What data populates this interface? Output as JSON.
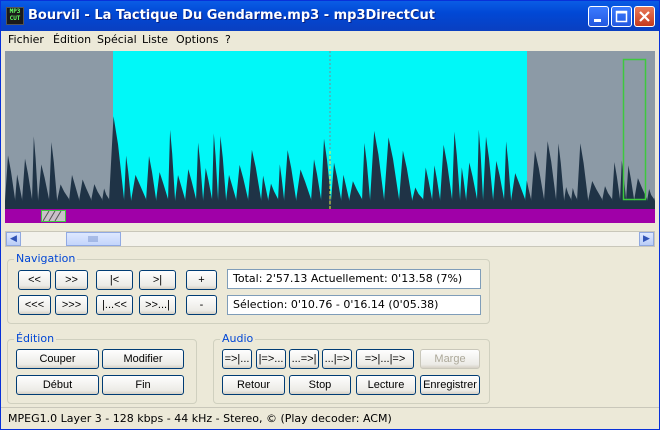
{
  "window": {
    "title": "Bourvil - La Tactique Du Gendarme.mp3 - mp3DirectCut"
  },
  "menu": [
    "Fichier",
    "Édition",
    "Spécial",
    "Liste",
    "Options",
    "?"
  ],
  "navigation": {
    "legend": "Navigation",
    "row1": [
      "<<",
      ">>",
      "|<",
      ">|",
      "+"
    ],
    "row2": [
      "<<<",
      ">>>",
      "|...<<",
      ">>...|",
      "-"
    ],
    "info_line": "Total: 2'57.13   Actuellement: 0'13.58   (7%)",
    "selection_line": "Sélection: 0'10.76 - 0'16.14 (0'05.38)"
  },
  "edition": {
    "legend": "Édition",
    "buttons": [
      "Couper",
      "Modifier",
      "Début",
      "Fin"
    ]
  },
  "audio": {
    "legend": "Audio",
    "row1": [
      "=>|...",
      "|=>...",
      "...=>|",
      "...|=>",
      "=>|...|=>",
      "Marge"
    ],
    "row2": [
      "Retour",
      "Stop",
      "Lecture",
      "Enregistrer"
    ]
  },
  "status": "MPEG1.0 Layer 3 - 128 kbps - 44 kHz - Stereo, ©   (Play decoder: ACM)",
  "colors": {
    "selection": "#00f8f8",
    "waveform": "#1f3346",
    "background": "#8c9aa6",
    "track": "#a000a8"
  }
}
